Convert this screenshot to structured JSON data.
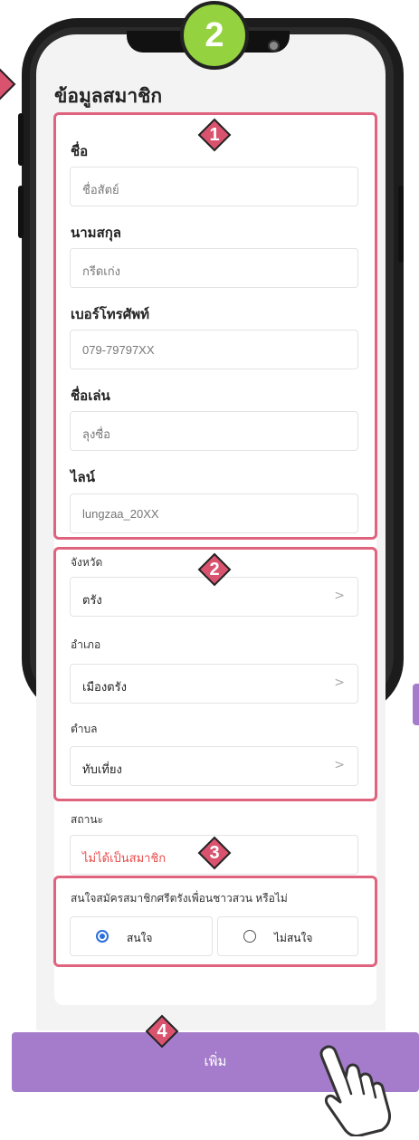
{
  "step_number": "2",
  "page_title": "ข้อมูลสมาชิก",
  "fields": [
    {
      "label": "ชื่อ",
      "value": "ชื่อสัตย์"
    },
    {
      "label": "นามสกุล",
      "value": "กรีดเก่ง"
    },
    {
      "label": "เบอร์โทรศัพท์",
      "value": "079-79797XX"
    },
    {
      "label": "ชื่อเล่น",
      "value": "ลุงซื่อ"
    },
    {
      "label": "ไลน์",
      "value": "lungzaa_20XX"
    }
  ],
  "location": [
    {
      "label": "จังหวัด",
      "value": "ตรัง"
    },
    {
      "label": "อำเภอ",
      "value": "เมืองตรัง"
    },
    {
      "label": "ตำบล",
      "value": "ทับเที่ยง"
    }
  ],
  "status": {
    "label": "สถานะ",
    "value": "ไม่ได้เป็นสมาชิก"
  },
  "interest": {
    "question": "สนใจสมัครสมาชิกศรีตรังเพื่อนชาวสวน หรือไม่",
    "option_yes": "สนใจ",
    "option_no": "ไม่สนใจ",
    "selected": "สนใจ"
  },
  "badges": [
    "1",
    "2",
    "3",
    "4"
  ],
  "add_button": "เพิ่ม",
  "colors": {
    "highlight": "#e0637e",
    "badge": "#d9536f",
    "step_circle": "#95d23f",
    "button": "#a57ccb",
    "status_red": "#e94b4b",
    "radio": "#2a6fdb"
  }
}
